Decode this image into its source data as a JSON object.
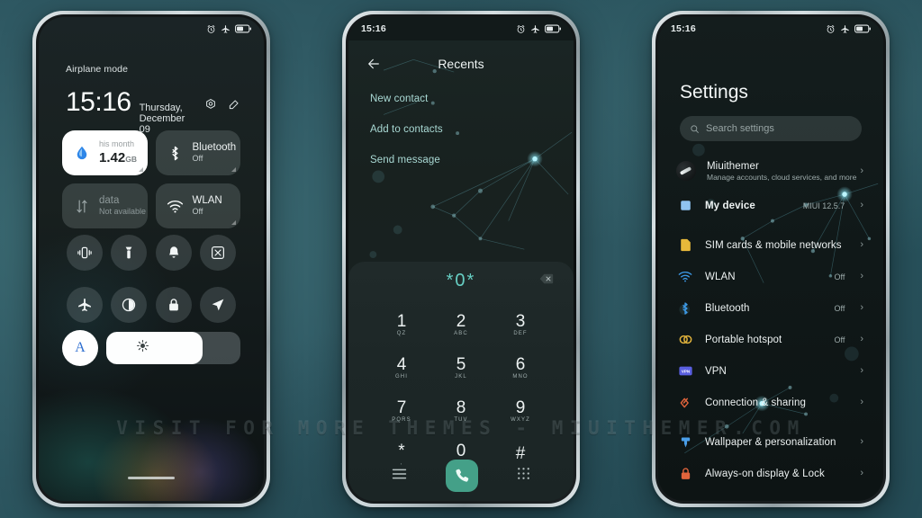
{
  "watermark": "VISIT  FOR  MORE  THEMES  -  MIUITHEMER.COM",
  "colors": {
    "accent_teal": "#67cfc4",
    "call_green": "#44a088",
    "menu_teal": "#a9d9d4",
    "background": "#2c555f"
  },
  "phone1": {
    "status": {
      "time": "",
      "icons": [
        "alarm-icon",
        "airplane-icon",
        "battery-icon"
      ]
    },
    "airplane_label": "Airplane mode",
    "clock": "15:16",
    "date": "Thursday, December 09",
    "header_icons": [
      "settings-gear-icon",
      "edit-icon"
    ],
    "tiles": [
      {
        "name": "data-usage",
        "icon": "water-drop-icon",
        "label": "his month",
        "value": "1.42",
        "unit": "GB",
        "style": "light"
      },
      {
        "name": "bluetooth",
        "icon": "bluetooth-icon",
        "label": "Bluetooth",
        "sub": "Off",
        "style": "dark"
      },
      {
        "name": "mobile-data",
        "icon": "data-arrows-icon",
        "label": "data",
        "sub": "Not available",
        "style": "dim"
      },
      {
        "name": "wlan",
        "icon": "wifi-icon",
        "label": "WLAN",
        "sub": "Off",
        "style": "dark"
      }
    ],
    "toggles": [
      {
        "name": "vibrate",
        "icon": "vibrate-icon"
      },
      {
        "name": "flashlight",
        "icon": "flashlight-icon"
      },
      {
        "name": "silent",
        "icon": "bell-icon"
      },
      {
        "name": "screenshot",
        "icon": "screenshot-icon"
      },
      {
        "name": "airplane-mode",
        "icon": "airplane-icon"
      },
      {
        "name": "dark-mode",
        "icon": "contrast-icon"
      },
      {
        "name": "lock",
        "icon": "lock-icon"
      },
      {
        "name": "location",
        "icon": "location-arrow-icon"
      }
    ],
    "brightness": {
      "auto_label": "A",
      "icon": "brightness-icon",
      "level": 72
    }
  },
  "phone2": {
    "status": {
      "time": "15:16",
      "icons": [
        "alarm-icon",
        "airplane-icon",
        "battery-icon"
      ]
    },
    "title": "Recents",
    "back_icon": "back-arrow-icon",
    "menu": [
      {
        "name": "new-contact",
        "label": "New contact"
      },
      {
        "name": "add-to-contacts",
        "label": "Add to contacts"
      },
      {
        "name": "send-message",
        "label": "Send message"
      }
    ],
    "entry": {
      "number": "*0*",
      "backspace_icon": "backspace-icon"
    },
    "keys": [
      {
        "digit": "1",
        "letters": "QZ"
      },
      {
        "digit": "2",
        "letters": "ABC"
      },
      {
        "digit": "3",
        "letters": "DEF"
      },
      {
        "digit": "4",
        "letters": "GHI"
      },
      {
        "digit": "5",
        "letters": "JKL"
      },
      {
        "digit": "6",
        "letters": "MNO"
      },
      {
        "digit": "7",
        "letters": "PQRS"
      },
      {
        "digit": "8",
        "letters": "TUV"
      },
      {
        "digit": "9",
        "letters": "WXYZ"
      },
      {
        "digit": "*",
        "letters": ","
      },
      {
        "digit": "0",
        "letters": "+"
      },
      {
        "digit": "#",
        "letters": ""
      }
    ],
    "navbar": [
      {
        "name": "menu-button",
        "icon": "hamburger-icon"
      },
      {
        "name": "call-button",
        "icon": "phone-call-icon"
      },
      {
        "name": "keypad-button",
        "icon": "keypad-icon"
      }
    ]
  },
  "phone3": {
    "status": {
      "time": "15:16",
      "icons": [
        "alarm-icon",
        "airplane-icon",
        "battery-icon"
      ]
    },
    "title": "Settings",
    "search": {
      "placeholder": "Search settings",
      "icon": "search-icon"
    },
    "account": {
      "name": "Miuithemer",
      "subtitle": "Manage accounts, cloud services, and more",
      "icon": "avatar"
    },
    "device": {
      "label": "My device",
      "value": "MIUI 12.5.7",
      "icon": "device-square-icon"
    },
    "items": [
      {
        "name": "sim-cards",
        "label": "SIM cards & mobile networks",
        "value": "",
        "icon": "sim-card-icon",
        "color": "#e8b93a"
      },
      {
        "name": "wlan",
        "label": "WLAN",
        "value": "Off",
        "icon": "wifi-icon",
        "color": "#3d9ae8"
      },
      {
        "name": "bluetooth",
        "label": "Bluetooth",
        "value": "Off",
        "icon": "bluetooth-icon",
        "color": "#3d9ae8"
      },
      {
        "name": "portable-hotspot",
        "label": "Portable hotspot",
        "value": "Off",
        "icon": "hotspot-icon",
        "color": "#e0b23c"
      },
      {
        "name": "vpn",
        "label": "VPN",
        "value": "",
        "icon": "vpn-icon",
        "color": "#5a5fe0"
      },
      {
        "name": "connection-sharing",
        "label": "Connection & sharing",
        "value": "",
        "icon": "sharing-icon",
        "color": "#e0643c"
      },
      {
        "name": "wallpaper-personalization",
        "label": "Wallpaper & personalization",
        "value": "",
        "icon": "brush-icon",
        "color": "#4a9ee8"
      },
      {
        "name": "always-on-display-lock",
        "label": "Always-on display & Lock",
        "value": "",
        "icon": "lock-screen-icon",
        "color": "#e0643c"
      }
    ],
    "chevron": "›"
  }
}
